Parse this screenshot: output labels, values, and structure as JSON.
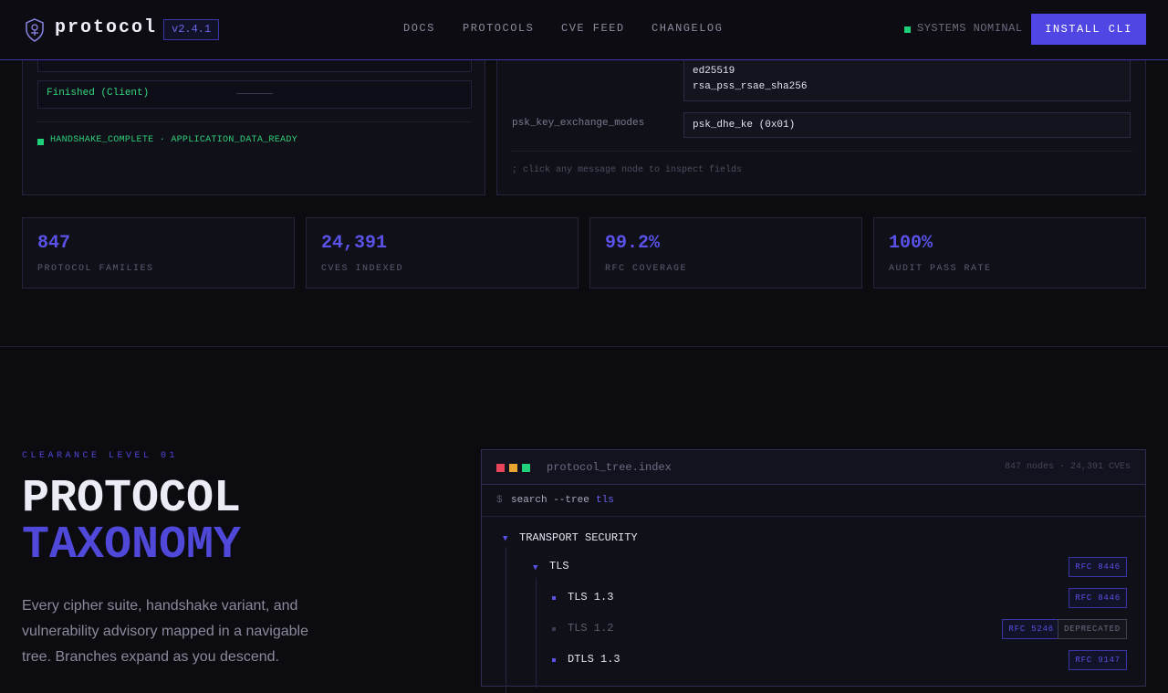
{
  "nav": {
    "brand": "protocol",
    "version": "v2.4.1",
    "links": [
      "DOCS",
      "PROTOCOLS",
      "CVE FEED",
      "CHANGELOG"
    ],
    "status": "SYSTEMS NOMINAL",
    "install": "INSTALL CLI"
  },
  "handshake": {
    "finished_label": "Finished (Client)",
    "status": "HANDSHAKE_COMPLETE · APPLICATION_DATA_READY"
  },
  "inspector": {
    "sig_values": [
      "ed25519",
      "rsa_pss_rsae_sha256"
    ],
    "psk_label": "psk_key_exchange_modes",
    "psk_value": "psk_dhe_ke (0x01)",
    "hint": "; click any message node to inspect fields"
  },
  "stats": [
    {
      "value": "847",
      "label": "PROTOCOL FAMILIES"
    },
    {
      "value": "24,391",
      "label": "CVES INDEXED"
    },
    {
      "value": "99.2%",
      "label": "RFC COVERAGE"
    },
    {
      "value": "100%",
      "label": "AUDIT PASS RATE"
    }
  ],
  "hero": {
    "eyebrow": "CLEARANCE LEVEL 01",
    "title_line1": "PROTOCOL",
    "title_line2": "TAXONOMY",
    "description": "Every cipher suite, handshake variant, and vulnerability advisory mapped in a navigable tree. Branches expand as you descend."
  },
  "tree": {
    "filename": "protocol_tree.index",
    "meta": "847 nodes · 24,391 CVEs",
    "prompt": "$",
    "command": "search --tree",
    "query": "tls",
    "nodes": {
      "root": "TRANSPORT SECURITY",
      "tls": "TLS",
      "tls13": "TLS 1.3",
      "tls12": "TLS 1.2",
      "dtls": "DTLS 1.3"
    },
    "tags": {
      "tls": "RFC 8446",
      "tls13": "RFC 8446",
      "tls12_rfc": "RFC 5246",
      "tls12_dep": "DEPRECATED",
      "dtls": "RFC 9147"
    }
  },
  "colors": {
    "accent": "#5046e4",
    "ok": "#1fd07a",
    "bg": "#0b0b10"
  }
}
